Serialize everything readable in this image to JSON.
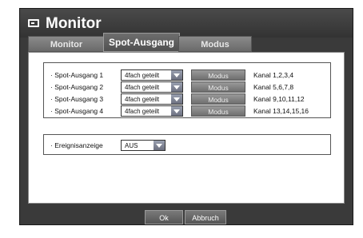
{
  "window": {
    "title": "Monitor",
    "icon": "monitor-icon"
  },
  "tabs": [
    {
      "label": "Monitor",
      "active": false
    },
    {
      "label": "Spot-Ausgang",
      "active": true
    },
    {
      "label": "Modus",
      "active": false
    }
  ],
  "spot_outputs": [
    {
      "label": "· Spot-Ausgang 1",
      "mode": "4fach geteilt",
      "button": "Modus",
      "channels": "Kanal 1,2,3,4"
    },
    {
      "label": "· Spot-Ausgang 2",
      "mode": "4fach geteilt",
      "button": "Modus",
      "channels": "Kanal 5,6,7,8"
    },
    {
      "label": "· Spot-Ausgang 3",
      "mode": "4fach geteilt",
      "button": "Modus",
      "channels": "Kanal 9,10,11,12"
    },
    {
      "label": "· Spot-Ausgang 4",
      "mode": "4fach geteilt",
      "button": "Modus",
      "channels": "Kanal 13,14,15,16"
    }
  ],
  "event_display": {
    "label": "· Ereignisanzeige",
    "value": "AUS"
  },
  "footer": {
    "ok_label": "Ok",
    "cancel_label": "Abbruch"
  }
}
